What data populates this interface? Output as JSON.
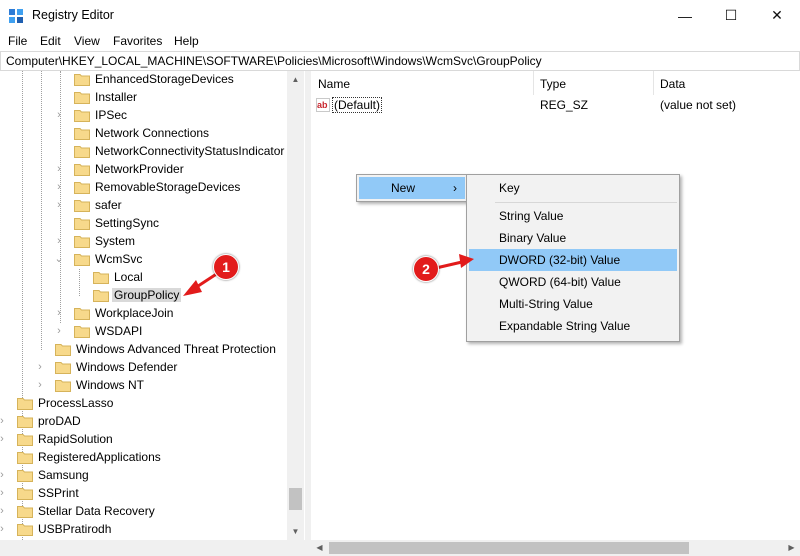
{
  "window": {
    "title": "Registry Editor",
    "minimize": "—",
    "maximize": "☐",
    "close": "✕"
  },
  "menu": [
    "File",
    "Edit",
    "View",
    "Favorites",
    "Help"
  ],
  "address": "Computer\\HKEY_LOCAL_MACHINE\\SOFTWARE\\Policies\\Microsoft\\Windows\\WcmSvc\\GroupPolicy",
  "tree": [
    {
      "label": "EnhancedStorageDevices",
      "expander": false
    },
    {
      "label": "Installer",
      "expander": false
    },
    {
      "label": "IPSec",
      "expander": true
    },
    {
      "label": "Network Connections",
      "expander": false
    },
    {
      "label": "NetworkConnectivityStatusIndicator",
      "expander": false
    },
    {
      "label": "NetworkProvider",
      "expander": true
    },
    {
      "label": "RemovableStorageDevices",
      "expander": true
    },
    {
      "label": "safer",
      "expander": true
    },
    {
      "label": "SettingSync",
      "expander": false
    },
    {
      "label": "System",
      "expander": true
    },
    {
      "label": "WcmSvc",
      "expander": "open"
    },
    {
      "label": "Local",
      "expander": false
    },
    {
      "label": "GroupPolicy",
      "expander": false,
      "selected": true
    },
    {
      "label": "WorkplaceJoin",
      "expander": true
    },
    {
      "label": "WSDAPI",
      "expander": true
    },
    {
      "label": "Windows Advanced Threat Protection",
      "expander": false
    },
    {
      "label": "Windows Defender",
      "expander": true
    },
    {
      "label": "Windows NT",
      "expander": true
    },
    {
      "label": "ProcessLasso",
      "expander": false
    },
    {
      "label": "proDAD",
      "expander": true
    },
    {
      "label": "RapidSolution",
      "expander": true
    },
    {
      "label": "RegisteredApplications",
      "expander": false
    },
    {
      "label": "Samsung",
      "expander": true
    },
    {
      "label": "SSPrint",
      "expander": true
    },
    {
      "label": "Stellar Data Recovery",
      "expander": true
    },
    {
      "label": "USBPratirodh",
      "expander": true
    }
  ],
  "columns": {
    "name": "Name",
    "type": "Type",
    "data": "Data"
  },
  "values": [
    {
      "name": "(Default)",
      "type": "REG_SZ",
      "data": "(value not set)",
      "icon": "string-value-icon"
    }
  ],
  "context_menu": {
    "new_label": "New",
    "submenu": [
      "Key",
      "String Value",
      "Binary Value",
      "DWORD (32-bit) Value",
      "QWORD (64-bit) Value",
      "Multi-String Value",
      "Expandable String Value"
    ],
    "highlighted": "DWORD (32-bit) Value"
  },
  "callouts": [
    "1",
    "2"
  ],
  "colors": {
    "highlight": "#91c9f7",
    "folder": "#f7d98b",
    "callout": "#e21b1b"
  }
}
